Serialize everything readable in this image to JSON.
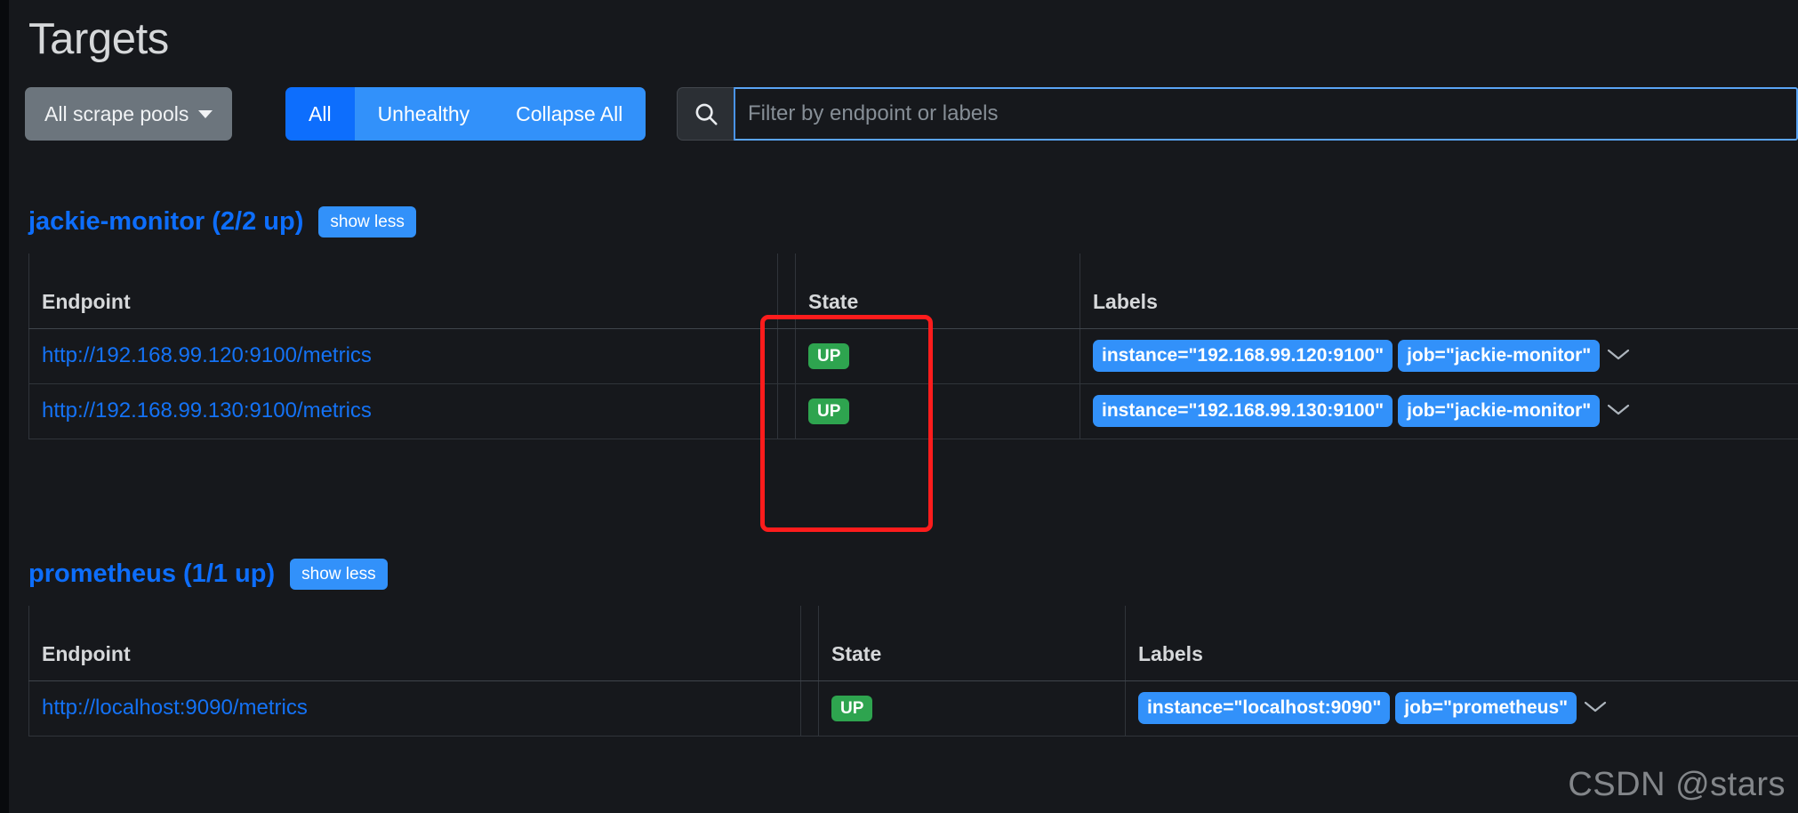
{
  "page": {
    "title": "Targets"
  },
  "toolbar": {
    "scrape_pool_dropdown": "All scrape pools",
    "filters": [
      {
        "label": "All",
        "active": true
      },
      {
        "label": "Unhealthy",
        "active": false
      },
      {
        "label": "Collapse All",
        "active": false
      }
    ],
    "search": {
      "placeholder": "Filter by endpoint or labels",
      "value": "",
      "icon": "search-icon",
      "focused": true
    }
  },
  "columns": {
    "endpoint": "Endpoint",
    "state": "State",
    "labels": "Labels"
  },
  "jobs": [
    {
      "title": "jackie-monitor (2/2 up)",
      "name": "jackie-monitor",
      "up_count": "2/2 up",
      "toggle_label": "show less",
      "targets": [
        {
          "endpoint": "http://192.168.99.120:9100/metrics",
          "state": "UP",
          "labels": [
            "instance=\"192.168.99.120:9100\"",
            "job=\"jackie-monitor\""
          ],
          "expand_icon": "chevron-down-icon"
        },
        {
          "endpoint": "http://192.168.99.130:9100/metrics",
          "state": "UP",
          "labels": [
            "instance=\"192.168.99.130:9100\"",
            "job=\"jackie-monitor\""
          ],
          "expand_icon": "chevron-down-icon"
        }
      ]
    },
    {
      "title": "prometheus (1/1 up)",
      "name": "prometheus",
      "up_count": "1/1 up",
      "toggle_label": "show less",
      "targets": [
        {
          "endpoint": "http://localhost:9090/metrics",
          "state": "UP",
          "labels": [
            "instance=\"localhost:9090\"",
            "job=\"prometheus\""
          ],
          "expand_icon": "chevron-down-icon"
        }
      ]
    }
  ],
  "annotation": {
    "type": "red-rectangle-highlight",
    "target": "state-column"
  },
  "watermark": "CSDN @stars",
  "colors": {
    "background": "#16181c",
    "accent_blue": "#0d6efd",
    "badge_blue": "#3291fa",
    "status_up_green": "#2ea44f",
    "annotation_red": "#fd1c1c",
    "link_blue": "#1472f5"
  }
}
